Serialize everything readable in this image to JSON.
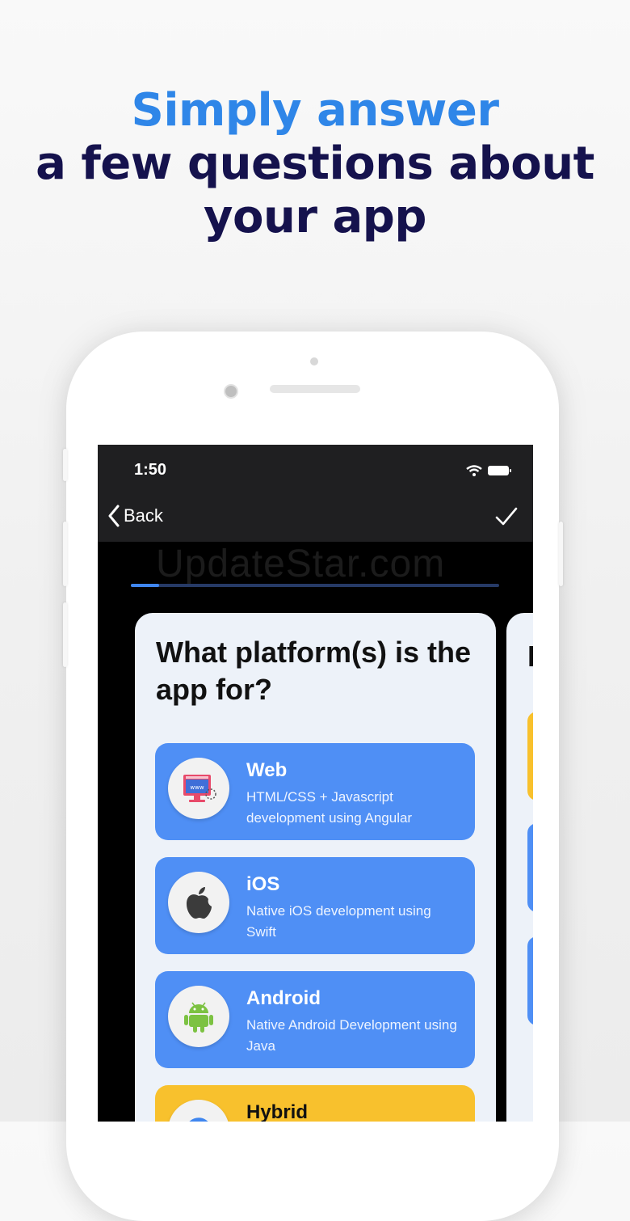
{
  "headline": {
    "line1": "Simply answer",
    "line2": "a few questions about",
    "line3": "your app"
  },
  "status_bar": {
    "time": "1:50"
  },
  "nav": {
    "back_label": "Back",
    "back_icon": "chevron-left-icon",
    "done_icon": "checkmark-icon"
  },
  "watermark": "UpdateStar.com",
  "progress": {
    "fraction": 0.077
  },
  "question": "What platform(s) is the app for?",
  "options": [
    {
      "title": "Web",
      "description": "HTML/CSS + Javascript development using Angular",
      "icon": "web-browser-icon"
    },
    {
      "title": "iOS",
      "description": "Native iOS development using Swift",
      "icon": "apple-icon"
    },
    {
      "title": "Android",
      "description": "Native Android Development using Java",
      "icon": "android-icon"
    },
    {
      "title": "Hybrid",
      "description": "",
      "icon": "hybrid-icon"
    }
  ],
  "next_card": {
    "title_fragment": "I"
  },
  "colors": {
    "accent_blue": "#4f8ff5",
    "accent_yellow": "#f8c12d",
    "headline_blue": "#2f86e8",
    "headline_navy": "#15124d"
  }
}
